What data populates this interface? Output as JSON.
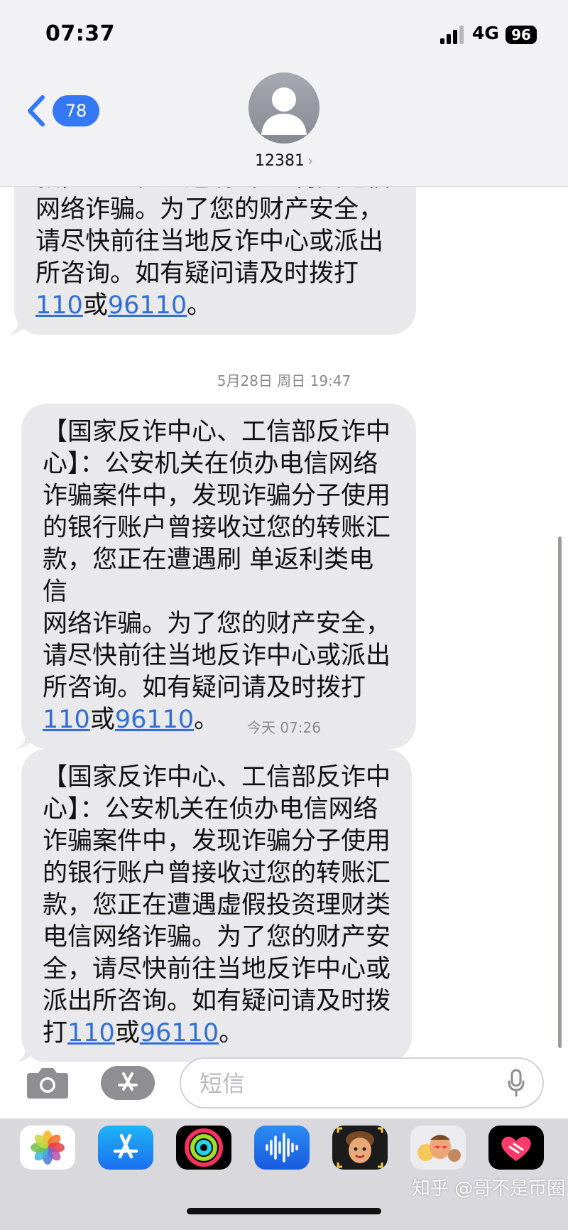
{
  "status_bar": {
    "time": "07:37",
    "network": "4G",
    "battery": "96"
  },
  "header": {
    "back_count": "78",
    "contact": "12381"
  },
  "messages": [
    {
      "lines": [
        "款，您正在遭遇刷 单返利类电信",
        "网络诈骗。为了您的财产安全，",
        "请尽快前往当地反诈中心或派出",
        "所咨询。如有疑问请及时拨打"
      ],
      "last_pre": "",
      "num1": "110",
      "mid": "或",
      "num2": "96110",
      "end": "。"
    },
    {
      "timestamp": "5月28日 周日 19:47",
      "lines": [
        "【国家反诈中心、工信部反诈中",
        "心】：公安机关在侦办电信网络",
        "诈骗案件中，发现诈骗分子使用",
        "的银行账户曾接收过您的转账汇",
        "款，您正在遭遇刷 单返利类电信",
        "网络诈骗。为了您的财产安全，",
        "请尽快前往当地反诈中心或派出",
        "所咨询。如有疑问请及时拨打"
      ],
      "last_pre": "",
      "num1": "110",
      "mid": "或",
      "num2": "96110",
      "end": "。"
    },
    {
      "timestamp": "今天 07:26",
      "lines": [
        "【国家反诈中心、工信部反诈中",
        "心】：公安机关在侦办电信网络",
        "诈骗案件中，发现诈骗分子使用",
        "的银行账户曾接收过您的转账汇",
        "款，您正在遭遇虚假投资理财类",
        "电信网络诈骗。为了您的财产安",
        "全，请尽快前往当地反诈中心或",
        "派出所咨询。如有疑问请及时拨"
      ],
      "last_pre": "打",
      "num1": "110",
      "mid": "或",
      "num2": "96110",
      "end": "。"
    }
  ],
  "composer": {
    "placeholder": "短信"
  },
  "app_drawer": {
    "apps": [
      "photos-icon",
      "app-store-icon",
      "activity-icon",
      "audio-message-icon",
      "memoji-icon",
      "memoji-stickers-icon",
      "digital-touch-icon"
    ]
  },
  "watermark": "知乎 @哥不是币圈",
  "colors": {
    "link": "#2f6fd8",
    "badge": "#3478f6",
    "bubble": "#e9e9eb"
  }
}
